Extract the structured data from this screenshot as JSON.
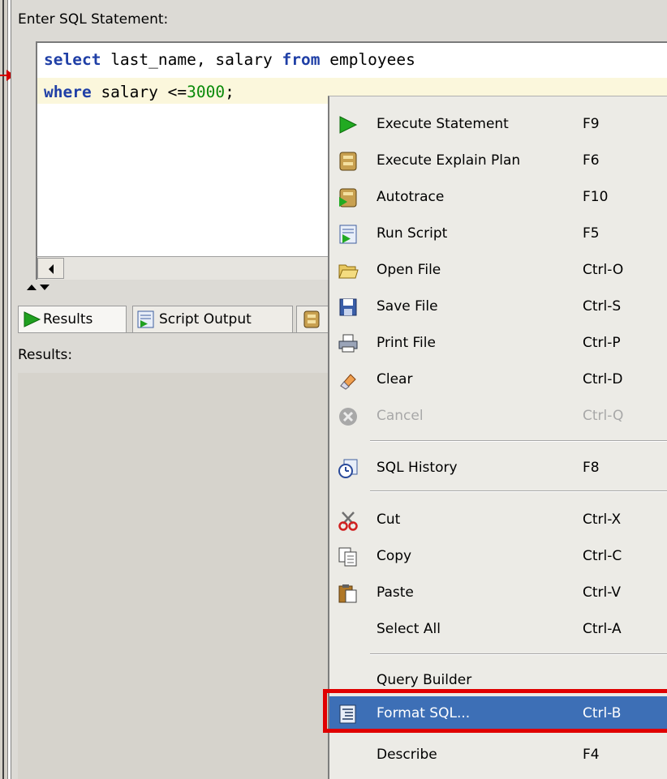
{
  "editor": {
    "label": "Enter SQL Statement:",
    "line1_kw1": "select",
    "line1_rest1": " last_name, salary ",
    "line1_kw2": "from",
    "line1_rest2": " employees",
    "line2_kw": "where",
    "line2_rest": " salary <=",
    "line2_num": "3000",
    "line2_end": ";"
  },
  "tabs": [
    {
      "label": "Results",
      "icon": "run-icon"
    },
    {
      "label": "Script Output",
      "icon": "script-icon"
    },
    {
      "label": "",
      "icon": "explain-icon"
    }
  ],
  "results": {
    "label": "Results:"
  },
  "menu": {
    "items": [
      {
        "label": "Execute Statement",
        "shortcut": "F9",
        "icon": "execute-icon"
      },
      {
        "label": "Execute Explain Plan",
        "shortcut": "F6",
        "icon": "explain-plan-icon"
      },
      {
        "label": "Autotrace",
        "shortcut": "F10",
        "icon": "autotrace-icon"
      },
      {
        "label": "Run Script",
        "shortcut": "F5",
        "icon": "run-script-icon"
      },
      {
        "label": "Open File",
        "shortcut": "Ctrl-O",
        "icon": "folder-icon"
      },
      {
        "label": "Save File",
        "shortcut": "Ctrl-S",
        "icon": "floppy-icon"
      },
      {
        "label": "Print File",
        "shortcut": "Ctrl-P",
        "icon": "printer-icon"
      },
      {
        "label": "Clear",
        "shortcut": "Ctrl-D",
        "icon": "eraser-icon"
      },
      {
        "label": "Cancel",
        "shortcut": "Ctrl-Q",
        "icon": "cancel-icon",
        "disabled": true
      },
      {
        "label": "SQL History",
        "shortcut": "F8",
        "icon": "history-icon"
      },
      {
        "label": "Cut",
        "shortcut": "Ctrl-X",
        "icon": "scissors-icon"
      },
      {
        "label": "Copy",
        "shortcut": "Ctrl-C",
        "icon": "copy-icon"
      },
      {
        "label": "Paste",
        "shortcut": "Ctrl-V",
        "icon": "paste-icon"
      },
      {
        "label": "Select All",
        "shortcut": "Ctrl-A",
        "icon": ""
      },
      {
        "label": "Query Builder",
        "shortcut": "",
        "icon": ""
      },
      {
        "label": "Format SQL...",
        "shortcut": "Ctrl-B",
        "icon": "format-icon",
        "selected": true
      },
      {
        "label": "Describe",
        "shortcut": "F4",
        "icon": ""
      }
    ]
  },
  "colors": {
    "menu_selected": "#3d6fb6",
    "highlight_box": "#e00000",
    "keyword": "#1f3fa6",
    "number": "#0a8a0a"
  }
}
